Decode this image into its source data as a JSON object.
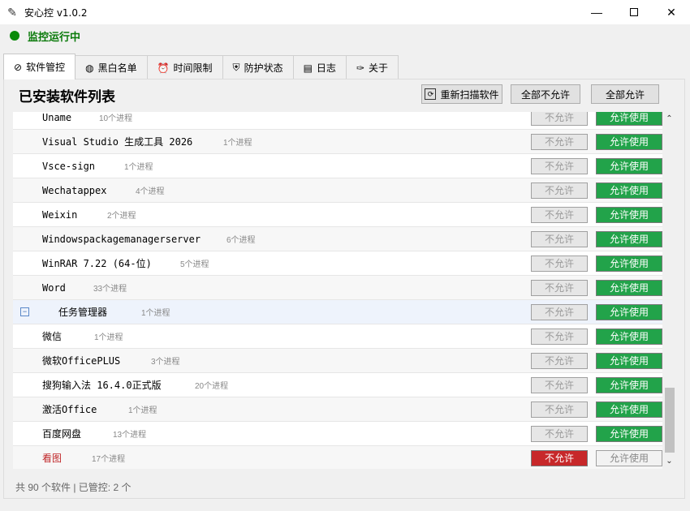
{
  "window": {
    "title": "安心控 v1.0.2"
  },
  "status": {
    "text": "监控运行中",
    "color": "#0a8a0a"
  },
  "tabs": [
    {
      "label": "软件管控",
      "icon": "block-icon"
    },
    {
      "label": "黑白名单",
      "icon": "globe-icon"
    },
    {
      "label": "时间限制",
      "icon": "alarm-clock-icon"
    },
    {
      "label": "防护状态",
      "icon": "shield-icon"
    },
    {
      "label": "日志",
      "icon": "clipboard-icon"
    },
    {
      "label": "关于",
      "icon": "pin-icon"
    }
  ],
  "panel": {
    "title": "已安装软件列表",
    "rescan_label": "重新扫描软件",
    "deny_all_label": "全部不允许",
    "allow_all_label": "全部允许"
  },
  "rows": [
    {
      "name": "Uname",
      "procs": "10个进程",
      "deny": "不允许",
      "allow": "允许使用",
      "state": "allowed"
    },
    {
      "name": "Visual Studio 生成工具 2026",
      "procs": "1个进程",
      "deny": "不允许",
      "allow": "允许使用",
      "state": "allowed"
    },
    {
      "name": "Vsce-sign",
      "procs": "1个进程",
      "deny": "不允许",
      "allow": "允许使用",
      "state": "allowed"
    },
    {
      "name": "Wechatappex",
      "procs": "4个进程",
      "deny": "不允许",
      "allow": "允许使用",
      "state": "allowed"
    },
    {
      "name": "Weixin",
      "procs": "2个进程",
      "deny": "不允许",
      "allow": "允许使用",
      "state": "allowed"
    },
    {
      "name": "Windowspackagemanagerserver",
      "procs": "6个进程",
      "deny": "不允许",
      "allow": "允许使用",
      "state": "allowed"
    },
    {
      "name": "WinRAR 7.22 (64-位)",
      "procs": "5个进程",
      "deny": "不允许",
      "allow": "允许使用",
      "state": "allowed"
    },
    {
      "name": "Word",
      "procs": "33个进程",
      "deny": "不允许",
      "allow": "允许使用",
      "state": "allowed"
    },
    {
      "name": "任务管理器",
      "procs": "1个进程",
      "deny": "不允许",
      "allow": "允许使用",
      "state": "allowed",
      "group": true
    },
    {
      "name": "微信",
      "procs": "1个进程",
      "deny": "不允许",
      "allow": "允许使用",
      "state": "allowed"
    },
    {
      "name": "微软OfficePLUS",
      "procs": "3个进程",
      "deny": "不允许",
      "allow": "允许使用",
      "state": "allowed"
    },
    {
      "name": "搜狗输入法 16.4.0正式版",
      "procs": "20个进程",
      "deny": "不允许",
      "allow": "允许使用",
      "state": "allowed"
    },
    {
      "name": "激活Office",
      "procs": "1个进程",
      "deny": "不允许",
      "allow": "允许使用",
      "state": "allowed"
    },
    {
      "name": "百度网盘",
      "procs": "13个进程",
      "deny": "不允许",
      "allow": "允许使用",
      "state": "allowed"
    },
    {
      "name": "看图",
      "procs": "17个进程",
      "deny": "不允许",
      "allow": "允许使用",
      "state": "denied"
    }
  ],
  "footer": {
    "text": "共 90 个软件 | 已管控: 2 个"
  },
  "colors": {
    "allow_green": "#22a34a",
    "deny_red": "#c7282a",
    "denied_name": "#c0282a",
    "group_name": "#2a5aa8"
  }
}
